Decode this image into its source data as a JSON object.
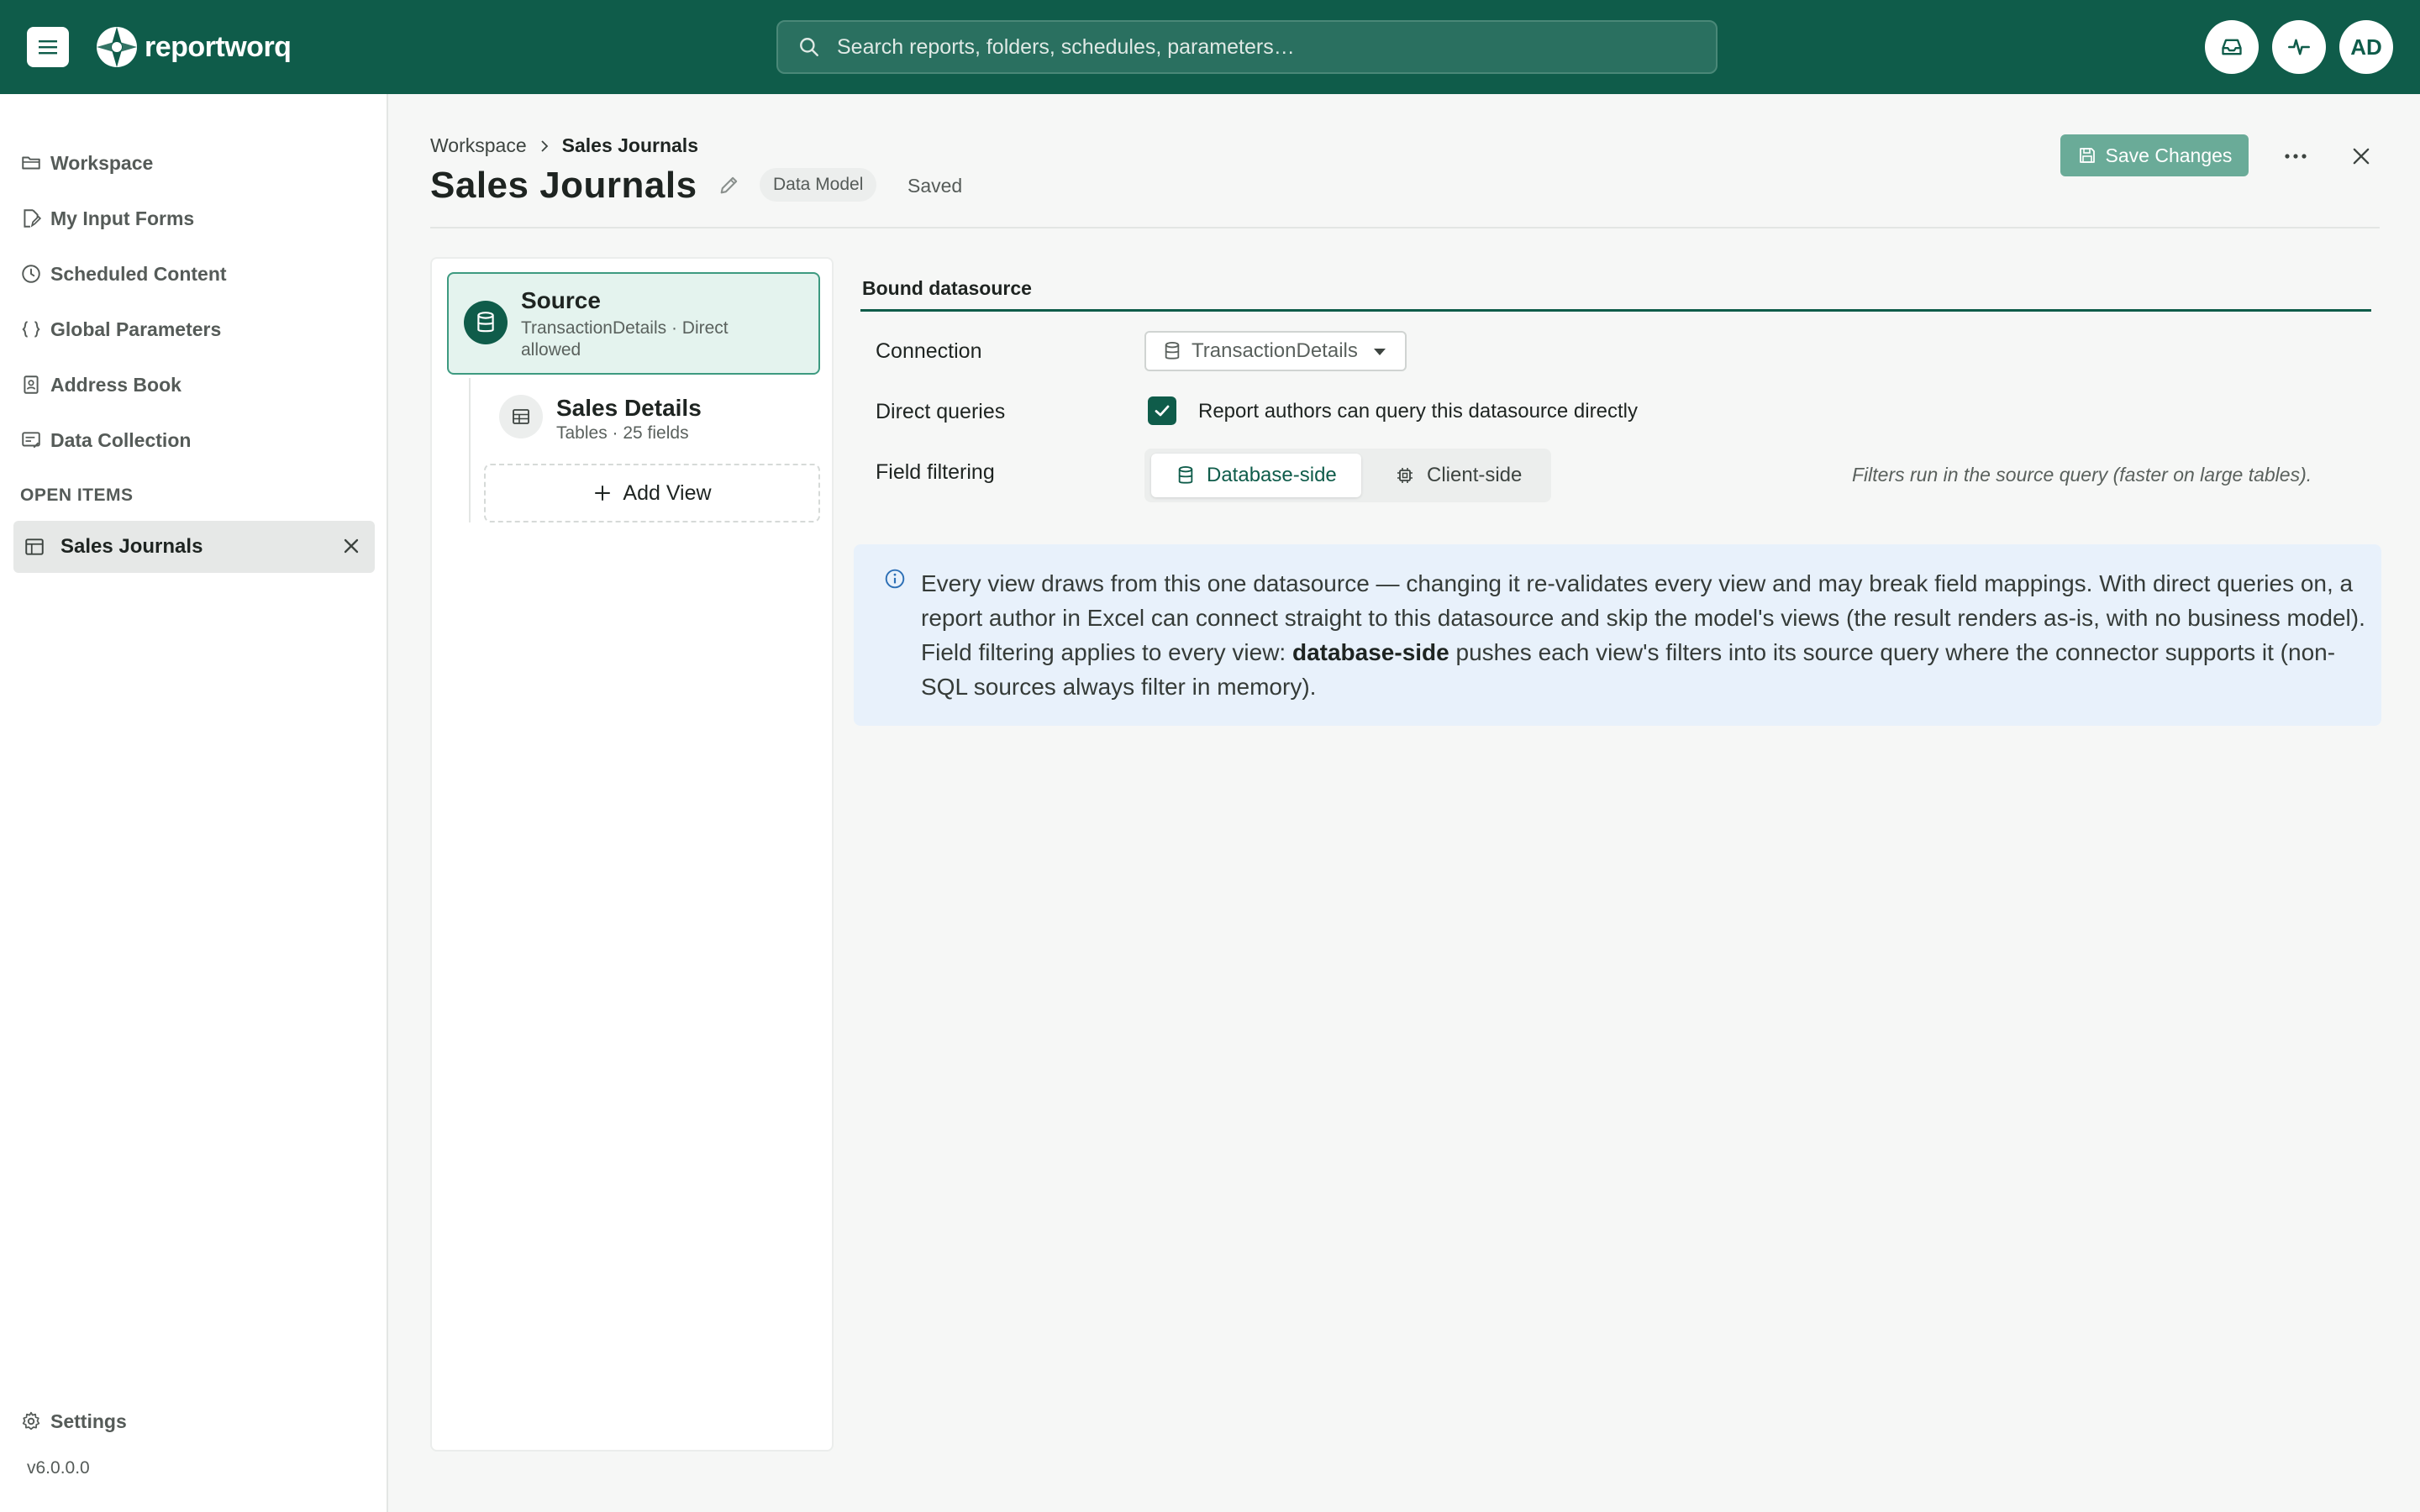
{
  "app": {
    "brand": "reportworq",
    "search_placeholder": "Search reports, folders, schedules, parameters…",
    "avatar_initials": "AD",
    "accent_color": "#0f5c4a"
  },
  "sidebar": {
    "items": [
      {
        "label": "Workspace",
        "icon": "folder-icon"
      },
      {
        "label": "My Input Forms",
        "icon": "form-edit-icon"
      },
      {
        "label": "Scheduled Content",
        "icon": "clock-icon"
      },
      {
        "label": "Global Parameters",
        "icon": "braces-icon"
      },
      {
        "label": "Address Book",
        "icon": "contact-book-icon"
      },
      {
        "label": "Data Collection",
        "icon": "data-collection-icon"
      }
    ],
    "open_items_label": "OPEN ITEMS",
    "open_items": [
      {
        "label": "Sales Journals",
        "icon": "table-icon"
      }
    ],
    "settings_label": "Settings",
    "version": "v6.0.0.0"
  },
  "header": {
    "breadcrumb": [
      "Workspace",
      "Sales Journals"
    ],
    "title": "Sales Journals",
    "badge": "Data Model",
    "status": "Saved",
    "save_label": "Save Changes"
  },
  "views": {
    "source": {
      "title": "Source",
      "subtitle": "TransactionDetails · Direct allowed"
    },
    "items": [
      {
        "title": "Sales Details",
        "subtitle": "Tables · 25 fields"
      }
    ],
    "add_label": "Add View"
  },
  "datasource": {
    "section_title": "Bound datasource",
    "connection_label": "Connection",
    "connection_value": "TransactionDetails",
    "direct_label": "Direct queries",
    "direct_checked": true,
    "direct_text": "Report authors can query this datasource directly",
    "filtering_label": "Field filtering",
    "filtering_options": [
      "Database-side",
      "Client-side"
    ],
    "filtering_selected": "Database-side",
    "filtering_hint": "Filters run in the source query (faster on large tables)."
  },
  "info": {
    "text_before": "Every view draws from this one datasource — changing it re-validates every view and may break field mappings. With direct queries on, a report author in Excel can connect straight to this datasource and skip the model's views (the result renders as-is, with no business model). Field filtering applies to every view: ",
    "text_bold": "database-side",
    "text_after": " pushes each view's filters into its source query where the connector supports it (non-SQL sources always filter in memory)."
  }
}
